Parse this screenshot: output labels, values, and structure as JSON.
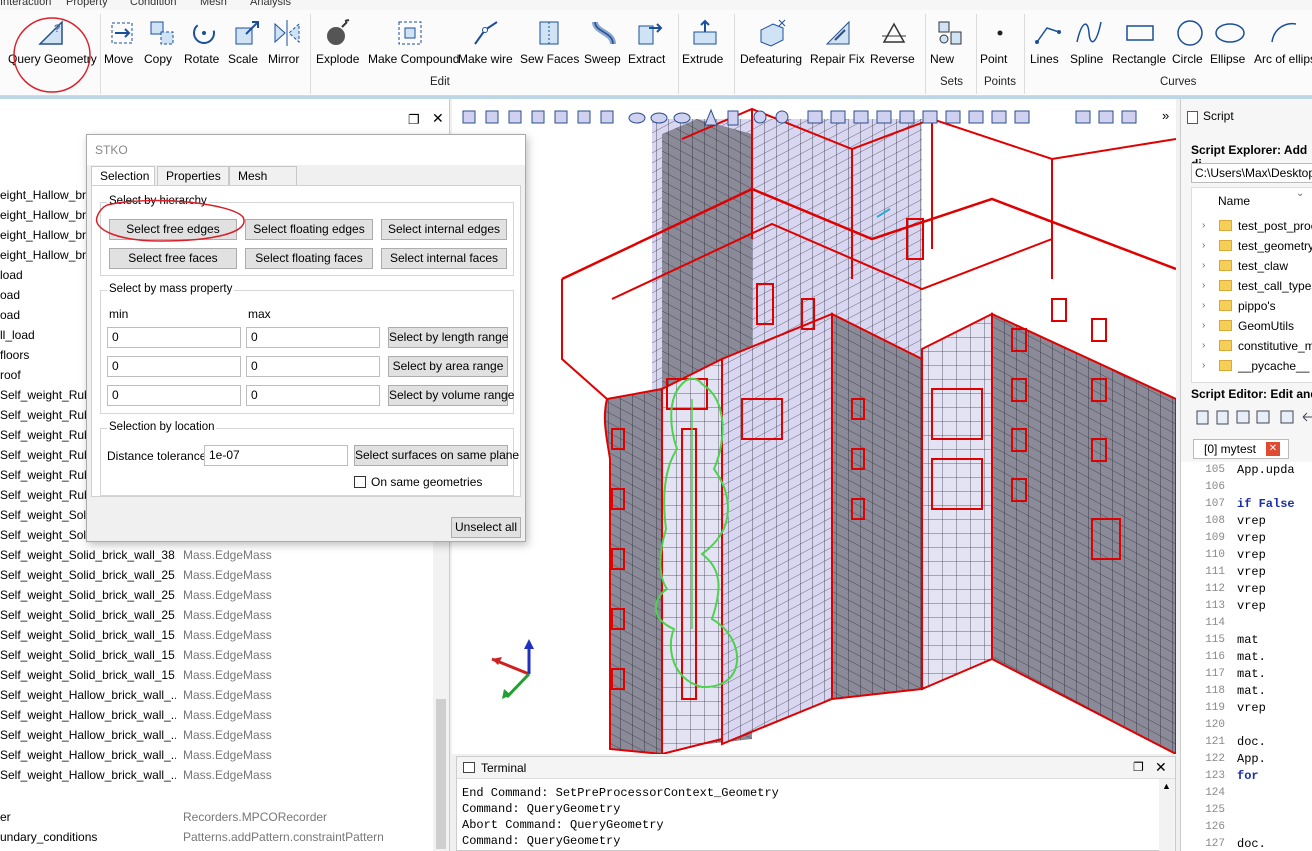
{
  "ribbon": {
    "tabs": [
      "Interaction",
      "Property",
      "Condition",
      "Mesh",
      "Analysis"
    ],
    "buttons": [
      "Query Geometry",
      "Move",
      "Copy",
      "Rotate",
      "Scale",
      "Mirror",
      "Explode",
      "Make Compound",
      "Make wire",
      "Sew Faces",
      "Sweep",
      "Extract",
      "Extrude",
      "Defeaturing",
      "Repair Fix",
      "Reverse",
      "New",
      "Point",
      "Lines",
      "Spline",
      "Rectangle",
      "Circle",
      "Ellipse",
      "Arc of ellipse"
    ],
    "groups": [
      "Edit",
      "Sets",
      "Points",
      "Curves"
    ]
  },
  "left_panel": {
    "rows": [
      {
        "name": "eight_Hallow_brick",
        "type": ""
      },
      {
        "name": "eight_Hallow_brick",
        "type": ""
      },
      {
        "name": "eight_Hallow_brick",
        "type": ""
      },
      {
        "name": "eight_Hallow_brick",
        "type": ""
      },
      {
        "name": "load",
        "type": ""
      },
      {
        "name": "oad",
        "type": ""
      },
      {
        "name": "oad",
        "type": ""
      },
      {
        "name": "ll_load",
        "type": ""
      },
      {
        "name": "floors",
        "type": ""
      },
      {
        "name": "roof",
        "type": ""
      },
      {
        "name": "Self_weight_Rubble",
        "type": ""
      },
      {
        "name": "Self_weight_Rubble",
        "type": ""
      },
      {
        "name": "Self_weight_Rubble",
        "type": ""
      },
      {
        "name": "Self_weight_Rubble",
        "type": ""
      },
      {
        "name": "Self_weight_Rubble",
        "type": ""
      },
      {
        "name": "Self_weight_Rubble",
        "type": ""
      },
      {
        "name": "Self_weight_Solid",
        "type": ""
      },
      {
        "name": "Self_weight_Solid",
        "type": ""
      },
      {
        "name": "Self_weight_Solid_brick_wall_38...",
        "type": "Mass.EdgeMass"
      },
      {
        "name": "Self_weight_Solid_brick_wall_25...",
        "type": "Mass.EdgeMass"
      },
      {
        "name": "Self_weight_Solid_brick_wall_25...",
        "type": "Mass.EdgeMass"
      },
      {
        "name": "Self_weight_Solid_brick_wall_25...",
        "type": "Mass.EdgeMass"
      },
      {
        "name": "Self_weight_Solid_brick_wall_15...",
        "type": "Mass.EdgeMass"
      },
      {
        "name": "Self_weight_Solid_brick_wall_15...",
        "type": "Mass.EdgeMass"
      },
      {
        "name": "Self_weight_Solid_brick_wall_15...",
        "type": "Mass.EdgeMass"
      },
      {
        "name": "Self_weight_Hallow_brick_wall_...",
        "type": "Mass.EdgeMass"
      },
      {
        "name": "Self_weight_Hallow_brick_wall_...",
        "type": "Mass.EdgeMass"
      },
      {
        "name": "Self_weight_Hallow_brick_wall_...",
        "type": "Mass.EdgeMass"
      },
      {
        "name": "Self_weight_Hallow_brick_wall_...",
        "type": "Mass.EdgeMass"
      },
      {
        "name": "Self_weight_Hallow_brick_wall_...",
        "type": "Mass.EdgeMass"
      }
    ],
    "extra_rows": [
      {
        "name": "er",
        "type": "Recorders.MPCORecorder"
      },
      {
        "name": "undary_conditions",
        "type": "Patterns.addPattern.constraintPattern"
      }
    ]
  },
  "dialog": {
    "title": "STKO",
    "tabs": [
      "Selection",
      "Properties",
      "Mesh info"
    ],
    "hierarchy": {
      "title": "Select by hierarchy",
      "buttons": [
        "Select free edges",
        "Select floating edges",
        "Select internal edges",
        "Select free faces",
        "Select floating faces",
        "Select internal faces"
      ]
    },
    "mass": {
      "title": "Select by mass property",
      "min_label": "min",
      "max_label": "max",
      "rows": [
        {
          "min": "0",
          "max": "0",
          "button": "Select by length range"
        },
        {
          "min": "0",
          "max": "0",
          "button": "Select by area range"
        },
        {
          "min": "0",
          "max": "0",
          "button": "Select by volume range"
        }
      ]
    },
    "location": {
      "title": "Selection by location",
      "tolerance_label": "Distance tolerance",
      "tolerance_value": "1e-07",
      "button": "Select surfaces on same plane",
      "checkbox_label": "On same geometries"
    },
    "unselect": "Unselect all"
  },
  "terminal": {
    "title": "Terminal",
    "lines": [
      "End Command: SetPreProcessorContext_Geometry",
      "Command: QueryGeometry",
      "Abort Command: QueryGeometry",
      "Command: QueryGeometry"
    ]
  },
  "script": {
    "title": "Script",
    "explorer_label": "Script Explorer: Add di",
    "path": "C:\\Users\\Max\\Desktop\\",
    "name_header": "Name",
    "folders": [
      "test_post_proc",
      "test_geometry",
      "test_claw",
      "test_call_types",
      "pippo's",
      "GeomUtils",
      "constitutive_m",
      "__pycache__"
    ],
    "editor_label": "Script Editor: Edit and r",
    "file_tab": "[0] mytest",
    "code": [
      {
        "ln": "105",
        "text": "App.upda"
      },
      {
        "ln": "106",
        "text": ""
      },
      {
        "ln": "107",
        "text": "if False"
      },
      {
        "ln": "108",
        "text": "vrep"
      },
      {
        "ln": "109",
        "text": "vrep"
      },
      {
        "ln": "110",
        "text": "vrep"
      },
      {
        "ln": "111",
        "text": "vrep"
      },
      {
        "ln": "112",
        "text": "vrep"
      },
      {
        "ln": "113",
        "text": "vrep"
      },
      {
        "ln": "114",
        "text": ""
      },
      {
        "ln": "115",
        "text": "mat"
      },
      {
        "ln": "116",
        "text": "mat."
      },
      {
        "ln": "117",
        "text": "mat."
      },
      {
        "ln": "118",
        "text": "mat."
      },
      {
        "ln": "119",
        "text": "vrep"
      },
      {
        "ln": "120",
        "text": ""
      },
      {
        "ln": "121",
        "text": "doc."
      },
      {
        "ln": "122",
        "text": "App."
      },
      {
        "ln": "123",
        "text": "for"
      },
      {
        "ln": "124",
        "text": ""
      },
      {
        "ln": "125",
        "text": ""
      },
      {
        "ln": "126",
        "text": ""
      },
      {
        "ln": "127",
        "text": "doc."
      }
    ]
  },
  "colors": {
    "accent": "#0078d7",
    "annotation_red": "#d8202a",
    "annotation_green": "#4cd24c",
    "edge_red": "#e00000",
    "wall_face": "#d8d6f0"
  }
}
